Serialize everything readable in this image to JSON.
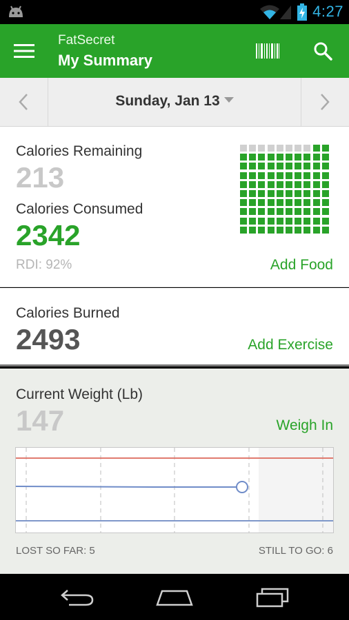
{
  "status_bar": {
    "time": "4:27"
  },
  "action_bar": {
    "app_name": "FatSecret",
    "title": "My Summary"
  },
  "date_nav": {
    "date": "Sunday, Jan 13"
  },
  "calories": {
    "remaining_label": "Calories Remaining",
    "remaining_value": "213",
    "consumed_label": "Calories Consumed",
    "consumed_value": "2342",
    "rdi": "RDI: 92%",
    "add_food": "Add Food",
    "rdi_fraction": 0.92
  },
  "burned": {
    "label": "Calories Burned",
    "value": "2493",
    "add_exercise": "Add Exercise"
  },
  "weight": {
    "label": "Current Weight (Lb)",
    "value": "147",
    "weigh_in": "Weigh In",
    "lost_so_far": "LOST SO FAR: 5",
    "still_to_go": "STILL TO GO: 6"
  },
  "colors": {
    "brand_green": "#29a329",
    "clock_blue": "#33b5e5"
  }
}
